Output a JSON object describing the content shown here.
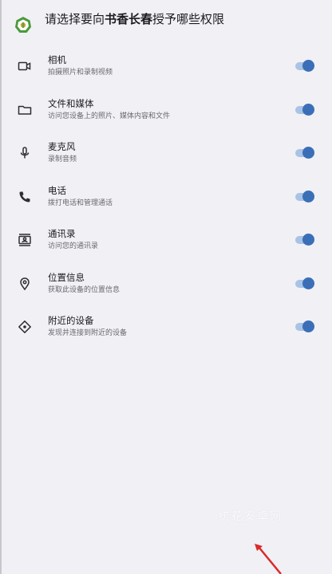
{
  "header": {
    "prefix": "请选择要向",
    "app_name": "书香长春",
    "suffix": "授予哪些权限"
  },
  "accent_color": "#3a6fb8",
  "permissions": [
    {
      "icon": "camera-icon",
      "title": "相机",
      "desc": "拍摄照片和录制视频",
      "enabled": true
    },
    {
      "icon": "folder-icon",
      "title": "文件和媒体",
      "desc": "访问您设备上的照片、媒体内容和文件",
      "enabled": true
    },
    {
      "icon": "microphone-icon",
      "title": "麦克风",
      "desc": "录制音频",
      "enabled": true
    },
    {
      "icon": "phone-icon",
      "title": "电话",
      "desc": "拨打电话和管理通话",
      "enabled": true
    },
    {
      "icon": "contacts-icon",
      "title": "通讯录",
      "desc": "访问您的通讯录",
      "enabled": true
    },
    {
      "icon": "location-icon",
      "title": "位置信息",
      "desc": "获取此设备的位置信息",
      "enabled": true
    },
    {
      "icon": "nearby-devices-icon",
      "title": "附近的设备",
      "desc": "发现并连接到附近的设备",
      "enabled": true
    }
  ],
  "watermark": "统花安卓网"
}
